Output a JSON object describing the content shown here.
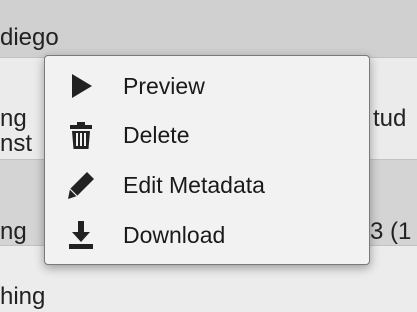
{
  "background": {
    "rows": [
      {
        "text_left": "diego"
      },
      {
        "text_left_line1": "ng",
        "text_left_line2": "nst",
        "text_right": "tud"
      },
      {
        "text_left": "ng",
        "text_right": "3 (1"
      },
      {
        "text_left": "hing"
      }
    ]
  },
  "context_menu": {
    "items": [
      {
        "label": "Preview",
        "icon": "play-icon"
      },
      {
        "label": "Delete",
        "icon": "trash-icon"
      },
      {
        "label": "Edit Metadata",
        "icon": "pencil-icon"
      },
      {
        "label": "Download",
        "icon": "download-icon"
      }
    ]
  },
  "colors": {
    "menu_background": "#f2f2f2",
    "menu_border": "#7a7a7a",
    "icon": "#222222"
  }
}
